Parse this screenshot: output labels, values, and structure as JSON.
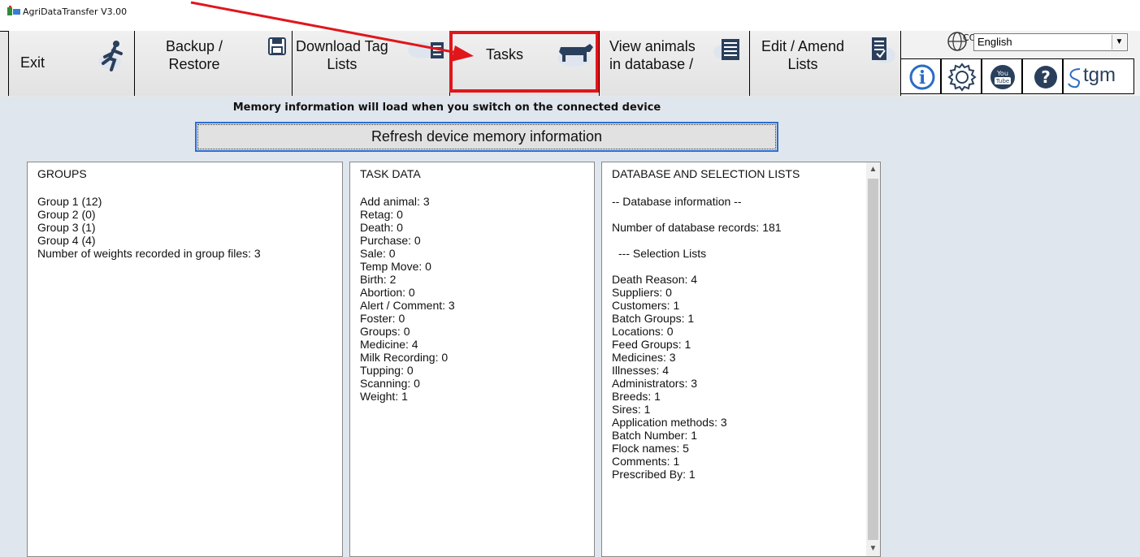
{
  "window": {
    "title": "AgriDataTransfer V3.00"
  },
  "toolbar": {
    "exit_label": "Exit",
    "backup_label": "Backup /\nRestore",
    "download_label": "Download Tag\nLists",
    "tasks_label": "Tasks",
    "view_label": "View animals\nin database /",
    "edit_label": "Edit / Amend\nLists"
  },
  "language": {
    "selected": "English",
    "cc_text": "CC"
  },
  "brand": {
    "logo_text": "tgm"
  },
  "main": {
    "memory_info": "Memory information will load when you switch on the connected device",
    "refresh_label": "Refresh device memory information"
  },
  "groups": {
    "heading": "GROUPS",
    "items": [
      "Group 1 (12)",
      "Group 2 (0)",
      "Group 3 (1)",
      "Group 4 (4)",
      "Number of weights recorded in group files: 3"
    ]
  },
  "task_data": {
    "heading": "TASK DATA",
    "items": [
      "Add animal: 3",
      "Retag: 0",
      "Death: 0",
      "Purchase: 0",
      "Sale: 0",
      "Temp Move: 0",
      "Birth: 2",
      "Abortion: 0",
      "Alert / Comment: 3",
      "Foster: 0",
      "Groups: 0",
      "Medicine: 4",
      "Milk Recording: 0",
      "Tupping: 0",
      "Scanning: 0",
      "Weight: 1"
    ]
  },
  "database": {
    "heading": "DATABASE AND SELECTION LISTS",
    "db_info": "-- Database information --",
    "records": "Number of database records: 181",
    "selection_heading": "--- Selection Lists",
    "items": [
      "Death Reason: 4",
      "Suppliers: 0",
      "Customers: 1",
      "Batch Groups: 1",
      "Locations: 0",
      "Feed Groups: 1",
      "Medicines: 3",
      "Illnesses: 4",
      "Administrators: 3",
      "Breeds: 1",
      "Sires: 1",
      "Application methods: 3",
      "Batch Number: 1",
      "Flock names: 5",
      "Comments: 1",
      "Prescribed By: 1"
    ]
  },
  "colors": {
    "highlight": "#e0161b",
    "background": "#e0e6ed",
    "focus_border": "#2b6fd6"
  }
}
